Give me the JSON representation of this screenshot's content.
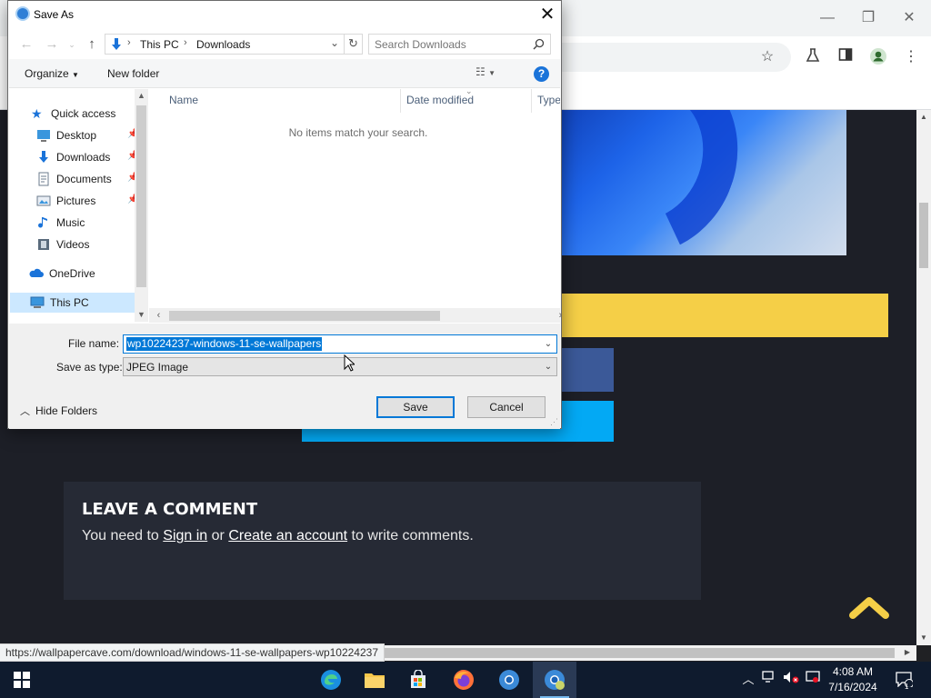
{
  "browser": {
    "window_controls": {
      "minimize": "—",
      "restore": "❐",
      "close": "✕"
    },
    "toolbar_icons": [
      "star-icon",
      "flask-icon",
      "sidebar-icon",
      "profile-icon",
      "menu-icon"
    ]
  },
  "page": {
    "comment_title": "LEAVE A COMMENT",
    "comment_prefix": "You need to ",
    "sign_in": "Sign in",
    "or": " or ",
    "create_account": "Create an account",
    "comment_suffix": " to write comments."
  },
  "status_url": "https://wallpapercave.com/download/windows-11-se-wallpapers-wp10224237",
  "dialog": {
    "title": "Save As",
    "breadcrumb": [
      "This PC",
      "Downloads"
    ],
    "search_placeholder": "Search Downloads",
    "organize": "Organize",
    "new_folder": "New folder",
    "help": "?",
    "nav": {
      "quick_access": "Quick access",
      "items": [
        {
          "label": "Desktop",
          "icon": "desktop-icon",
          "pinned": true
        },
        {
          "label": "Downloads",
          "icon": "download-icon",
          "pinned": true
        },
        {
          "label": "Documents",
          "icon": "documents-icon",
          "pinned": true
        },
        {
          "label": "Pictures",
          "icon": "pictures-icon",
          "pinned": true
        },
        {
          "label": "Music",
          "icon": "music-icon",
          "pinned": false
        },
        {
          "label": "Videos",
          "icon": "videos-icon",
          "pinned": false
        }
      ],
      "onedrive": "OneDrive",
      "this_pc": "This PC"
    },
    "columns": [
      "Name",
      "Date modified",
      "Type"
    ],
    "empty_message": "No items match your search.",
    "file_name_label": "File name:",
    "file_name_value": "wp10224237-windows-11-se-wallpapers",
    "save_as_type_label": "Save as type:",
    "save_as_type_value": "JPEG Image",
    "hide_folders": "Hide Folders",
    "save_button": "Save",
    "cancel_button": "Cancel"
  },
  "taskbar": {
    "apps": [
      "edge-icon",
      "file-explorer-icon",
      "store-icon",
      "firefox-icon",
      "chrome-canary-icon",
      "chrome-canary-active-icon"
    ],
    "time": "4:08 AM",
    "date": "7/16/2024",
    "notification_count": "1"
  },
  "colors": {
    "accent": "#0078d7",
    "page_bg": "#1d1f27",
    "yellow": "#f5cf47",
    "cyan": "#03a9f4",
    "taskbar": "#0f1b2e"
  }
}
